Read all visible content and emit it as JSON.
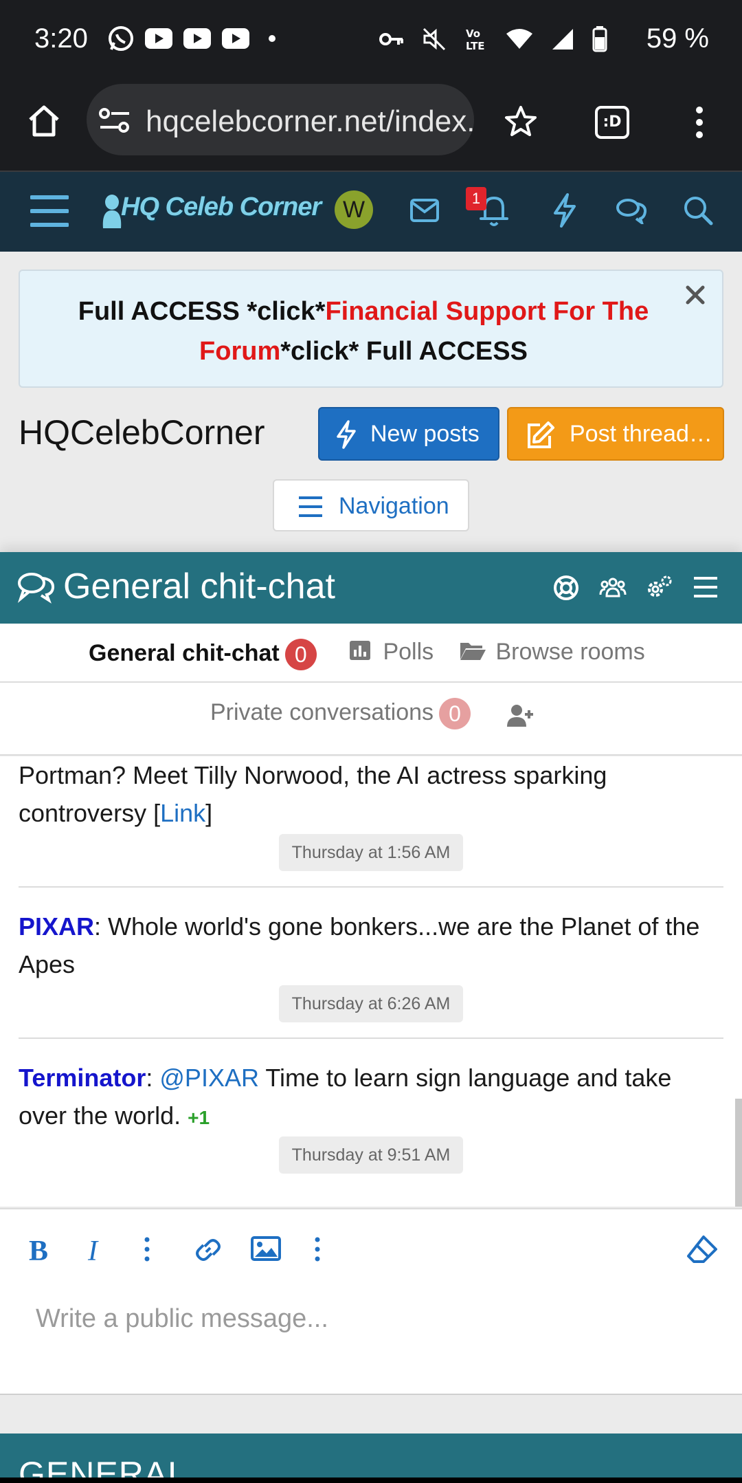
{
  "status_bar": {
    "time": "3:20",
    "battery": "59 %",
    "app_icons": [
      "whatsapp-icon",
      "youtube-icon",
      "youtube-icon",
      "youtube-icon",
      "dot-icon"
    ],
    "system_icons": [
      "vpn-key-icon",
      "mute-icon",
      "volte-icon",
      "wifi-icon",
      "signal-icon",
      "battery-icon"
    ]
  },
  "browser": {
    "url": "hqcelebcorner.net/index.php",
    "tab_count": ":D"
  },
  "forum_header": {
    "logo_text": "HQ Celeb Corner",
    "avatar_letter": "W",
    "notification_count": "1"
  },
  "notice": {
    "part1": "Full ACCESS *click*",
    "part2_red": "Financial Support For The Forum",
    "part3": "*click* Full ACCESS"
  },
  "site": {
    "title": "HQCelebCorner",
    "new_posts": "New posts",
    "post_thread": "Post thread…",
    "navigation": "Navigation"
  },
  "chat": {
    "title": "General chit-chat",
    "tabs": [
      {
        "label": "General chit-chat",
        "count": "0"
      },
      {
        "label": "Polls"
      },
      {
        "label": "Browse rooms"
      }
    ],
    "private": {
      "label": "Private conversations",
      "count": "0"
    },
    "messages": [
      {
        "text": "Portman? Meet Tilly Norwood, the AI actress sparking controversy [",
        "link": "Link",
        "tail": "]",
        "time": "Thursday at 1:56 AM"
      },
      {
        "user": "PIXAR",
        "text": ": Whole world's gone bonkers...we are the Planet of the Apes",
        "time": "Thursday at 6:26 AM"
      },
      {
        "user": "Terminator",
        "sep": ": ",
        "mention": "@PIXAR",
        "text": " Time to learn sign language and take over the world. ",
        "plus": "+1",
        "time": "Thursday at 9:51 AM"
      }
    ],
    "input_placeholder": "Write a public message..."
  },
  "next_section": {
    "title": "GENERAL"
  },
  "colors": {
    "teal_header": "#24707f",
    "forum_dark": "#183040",
    "blue_button": "#1e6fc2",
    "orange_button": "#f39a17",
    "red_text": "#e01818",
    "username": "#1515cc"
  }
}
